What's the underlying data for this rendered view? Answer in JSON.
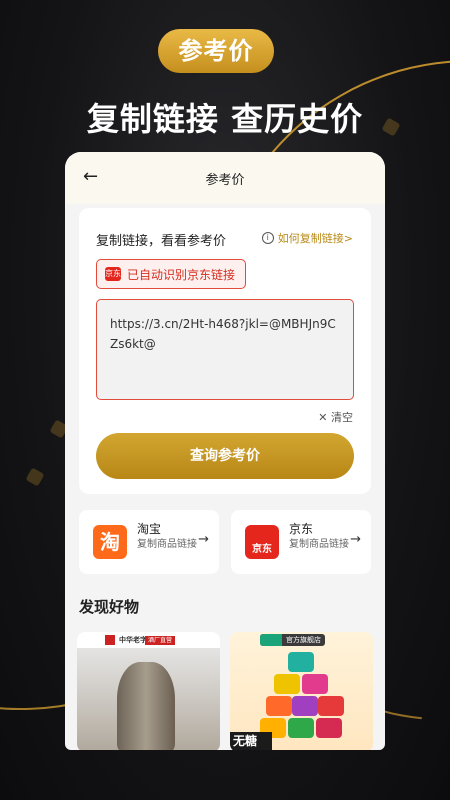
{
  "promo": {
    "badge": "参考价",
    "headline": "复制链接 查历史价"
  },
  "nav": {
    "back_icon": "arrow-left-icon",
    "title": "参考价"
  },
  "link_card": {
    "title": "复制链接，看看参考价",
    "howto_label": "如何复制链接>",
    "detected_label": "已自动识别京东链接",
    "jd_icon_text": "京东",
    "input_value": "https://3.cn/2Ht-h468?jkl=@MBHJn9CZs6kt@",
    "clear_label": "清空",
    "query_button": "查询参考价"
  },
  "sources": [
    {
      "name": "淘宝",
      "logo_text": "淘",
      "desc": "复制商品链接",
      "color": "#ff6a1a"
    },
    {
      "name": "京东",
      "logo_text": "京东",
      "desc": "复制商品链接",
      "color": "#e4261c"
    }
  ],
  "discover": {
    "title": "发现好物",
    "items": [
      {
        "brand": "中华老字号",
        "tag": "酒厂直营"
      },
      {
        "tag": "官方旗舰店",
        "text": "无糖"
      }
    ]
  },
  "colors": {
    "accent_gold": "#c9961f",
    "alert_red": "#e24a3a"
  }
}
